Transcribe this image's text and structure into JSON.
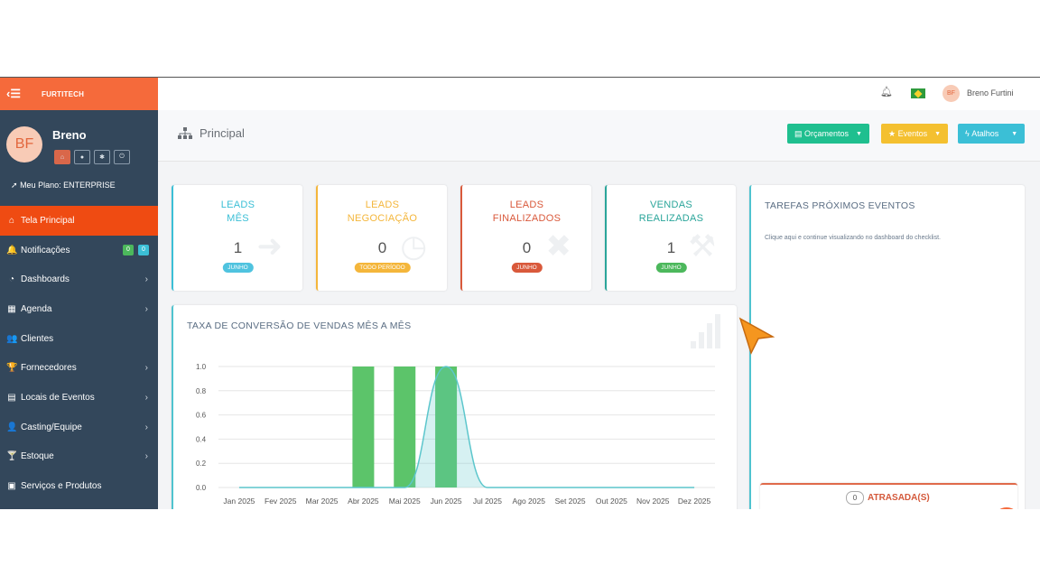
{
  "brand": "FURTITECH",
  "profile": {
    "initials": "BF",
    "name": "Breno",
    "plan": "Meu Plano: ENTERPRISE"
  },
  "sidebar": {
    "items": [
      {
        "label": "Tela Principal",
        "icon": "home-icon",
        "glyph": "⌂",
        "active": true
      },
      {
        "label": "Notificações",
        "icon": "bell-icon",
        "glyph": "🔔",
        "badges": [
          "0",
          "0"
        ]
      },
      {
        "label": "Dashboards",
        "icon": "dashboard-icon",
        "glyph": "◔",
        "arrow": true
      },
      {
        "label": "Agenda",
        "icon": "calendar-icon",
        "glyph": "▦",
        "arrow": true
      },
      {
        "label": "Clientes",
        "icon": "users-icon",
        "glyph": "👥"
      },
      {
        "label": "Fornecedores",
        "icon": "trophy-icon",
        "glyph": "🏆",
        "arrow": true
      },
      {
        "label": "Locais de Eventos",
        "icon": "building-icon",
        "glyph": "▤",
        "arrow": true
      },
      {
        "label": "Casting/Equipe",
        "icon": "person-icon",
        "glyph": "👤",
        "arrow": true
      },
      {
        "label": "Estoque",
        "icon": "glass-icon",
        "glyph": "🍸",
        "arrow": true
      },
      {
        "label": "Serviços e Produtos",
        "icon": "box-icon",
        "glyph": "▣"
      }
    ]
  },
  "topbar": {
    "user_initials": "BF",
    "user_name": "Breno Furtini"
  },
  "header": {
    "title": "Principal",
    "buttons": [
      {
        "label": "Orçamentos",
        "color": "#1fbf8f"
      },
      {
        "label": "Eventos",
        "color": "#f4c030"
      },
      {
        "label": "Atalhos",
        "color": "#3bbfd6"
      }
    ]
  },
  "stats": [
    {
      "line1": "LEADS",
      "line2": "MÊS",
      "value": "1",
      "pill": "JUNHO",
      "color": "#3bbfd6",
      "pill_color": "#4fc3df"
    },
    {
      "line1": "LEADS",
      "line2": "NEGOCIAÇÃO",
      "value": "0",
      "pill": "TODO PERÍODO",
      "color": "#f4b63b",
      "pill_color": "#f4b63b"
    },
    {
      "line1": "LEADS",
      "line2": "FINALIZADOS",
      "value": "0",
      "pill": "JUNHO",
      "color": "#d9593b",
      "pill_color": "#d9593b"
    },
    {
      "line1": "VENDAS",
      "line2": "REALIZADAS",
      "value": "1",
      "pill": "JUNHO",
      "color": "#2aa59a",
      "pill_color": "#4cb85c"
    }
  ],
  "chart_data": {
    "type": "bar",
    "title": "TAXA DE CONVERSÃO DE VENDAS MÊS A MÊS",
    "categories": [
      "Jan 2025",
      "Fev 2025",
      "Mar 2025",
      "Abr 2025",
      "Mai 2025",
      "Jun 2025",
      "Jul 2025",
      "Ago 2025",
      "Set 2025",
      "Out 2025",
      "Nov 2025",
      "Dez 2025"
    ],
    "series": [
      {
        "type": "bar",
        "color": "#5cc46a",
        "values": [
          0,
          0,
          0,
          1,
          1,
          1,
          0,
          0,
          0,
          0,
          0,
          0
        ]
      },
      {
        "type": "area",
        "color": "#5cc6cc",
        "values": [
          0,
          0,
          0,
          0,
          0,
          1,
          0,
          0,
          0,
          0,
          0,
          0
        ]
      }
    ],
    "yticks": [
      "0.0",
      "0.2",
      "0.4",
      "0.6",
      "0.8",
      "1.0"
    ],
    "ylim": [
      0,
      1
    ],
    "grid": true
  },
  "tasks": {
    "title": "TAREFAS PRÓXIMOS EVENTOS",
    "link": "Clique aqui e continue visualizando no dashboard do checklist.",
    "late_count": "0",
    "late_label": "ATRASADA(S)"
  }
}
